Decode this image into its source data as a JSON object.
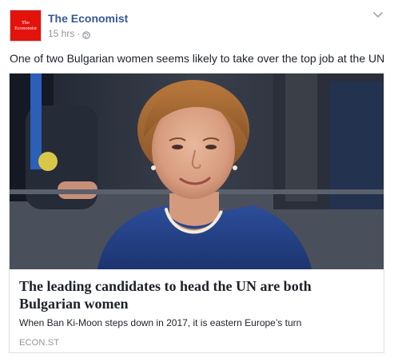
{
  "post": {
    "page_name": "The Economist",
    "avatar_text": [
      "The",
      "Economist"
    ],
    "timestamp": "15 hrs",
    "separator": "·",
    "privacy_icon": "globe-icon",
    "menu_icon": "chevron-down-icon",
    "text": "One of two Bulgarian women seems likely to take over the top job at the UN"
  },
  "link_card": {
    "image_icon": "portrait-photo",
    "title": "The leading candidates to head the UN are both Bulgarian women",
    "description": "When Ban Ki-Moon steps down in 2017, it is eastern Europe’s turn",
    "domain": "ECON.ST"
  },
  "colors": {
    "brand_red": "#e3120b",
    "link_blue": "#365899",
    "meta_gray": "#90949c",
    "text": "#1d2129",
    "card_border": "#dddfe2"
  }
}
